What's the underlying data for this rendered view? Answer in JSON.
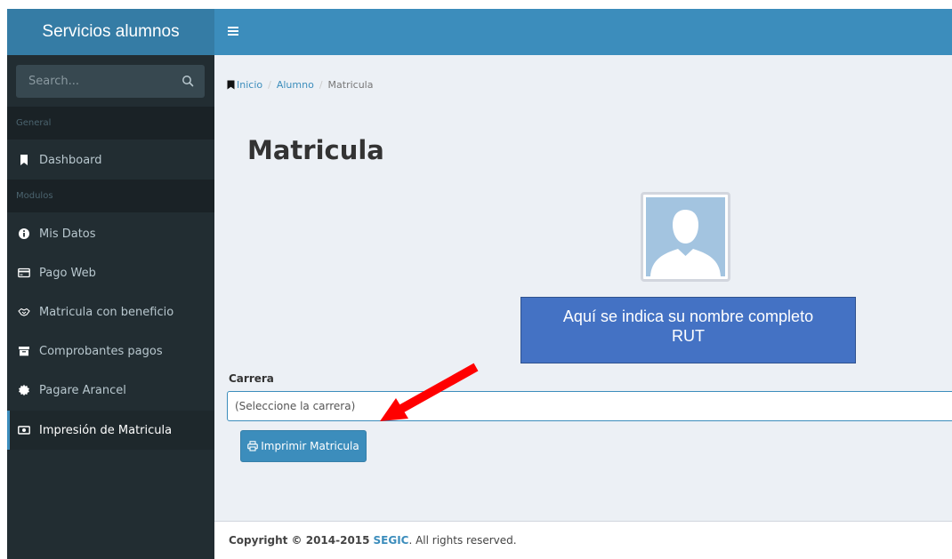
{
  "app": {
    "title": "Servicios alumnos"
  },
  "search": {
    "placeholder": "Search..."
  },
  "sidebar": {
    "sections": [
      {
        "label": "General"
      },
      {
        "label": "Modulos"
      }
    ],
    "items": [
      {
        "label": "Dashboard",
        "icon": "bookmark-icon"
      },
      {
        "label": "Mis Datos",
        "icon": "info-icon"
      },
      {
        "label": "Pago Web",
        "icon": "credit-card-icon"
      },
      {
        "label": "Matricula con beneficio",
        "icon": "handshake-icon"
      },
      {
        "label": "Comprobantes pagos",
        "icon": "archive-icon"
      },
      {
        "label": "Pagare Arancel",
        "icon": "certificate-icon"
      },
      {
        "label": "Impresión de Matricula",
        "icon": "money-icon",
        "active": true
      }
    ]
  },
  "breadcrumb": {
    "items": [
      "Inicio",
      "Alumno",
      "Matricula"
    ]
  },
  "main": {
    "title": "Matricula",
    "annotation_line1": "Aquí se indica su nombre completo",
    "annotation_line2": "RUT",
    "field_label": "Carrera",
    "select_value": "(Seleccione la carrera)",
    "print_button": "Imprimir Matricula"
  },
  "footer": {
    "copyright": "Copyright © 2014-2015",
    "brand": "SEGIC",
    "rights": ". All rights reserved."
  },
  "colors": {
    "sidebar_bg": "#222d32",
    "header_blue": "#3c8dbc",
    "annotation_blue": "#4472c4",
    "arrow_red": "#ff0000"
  }
}
